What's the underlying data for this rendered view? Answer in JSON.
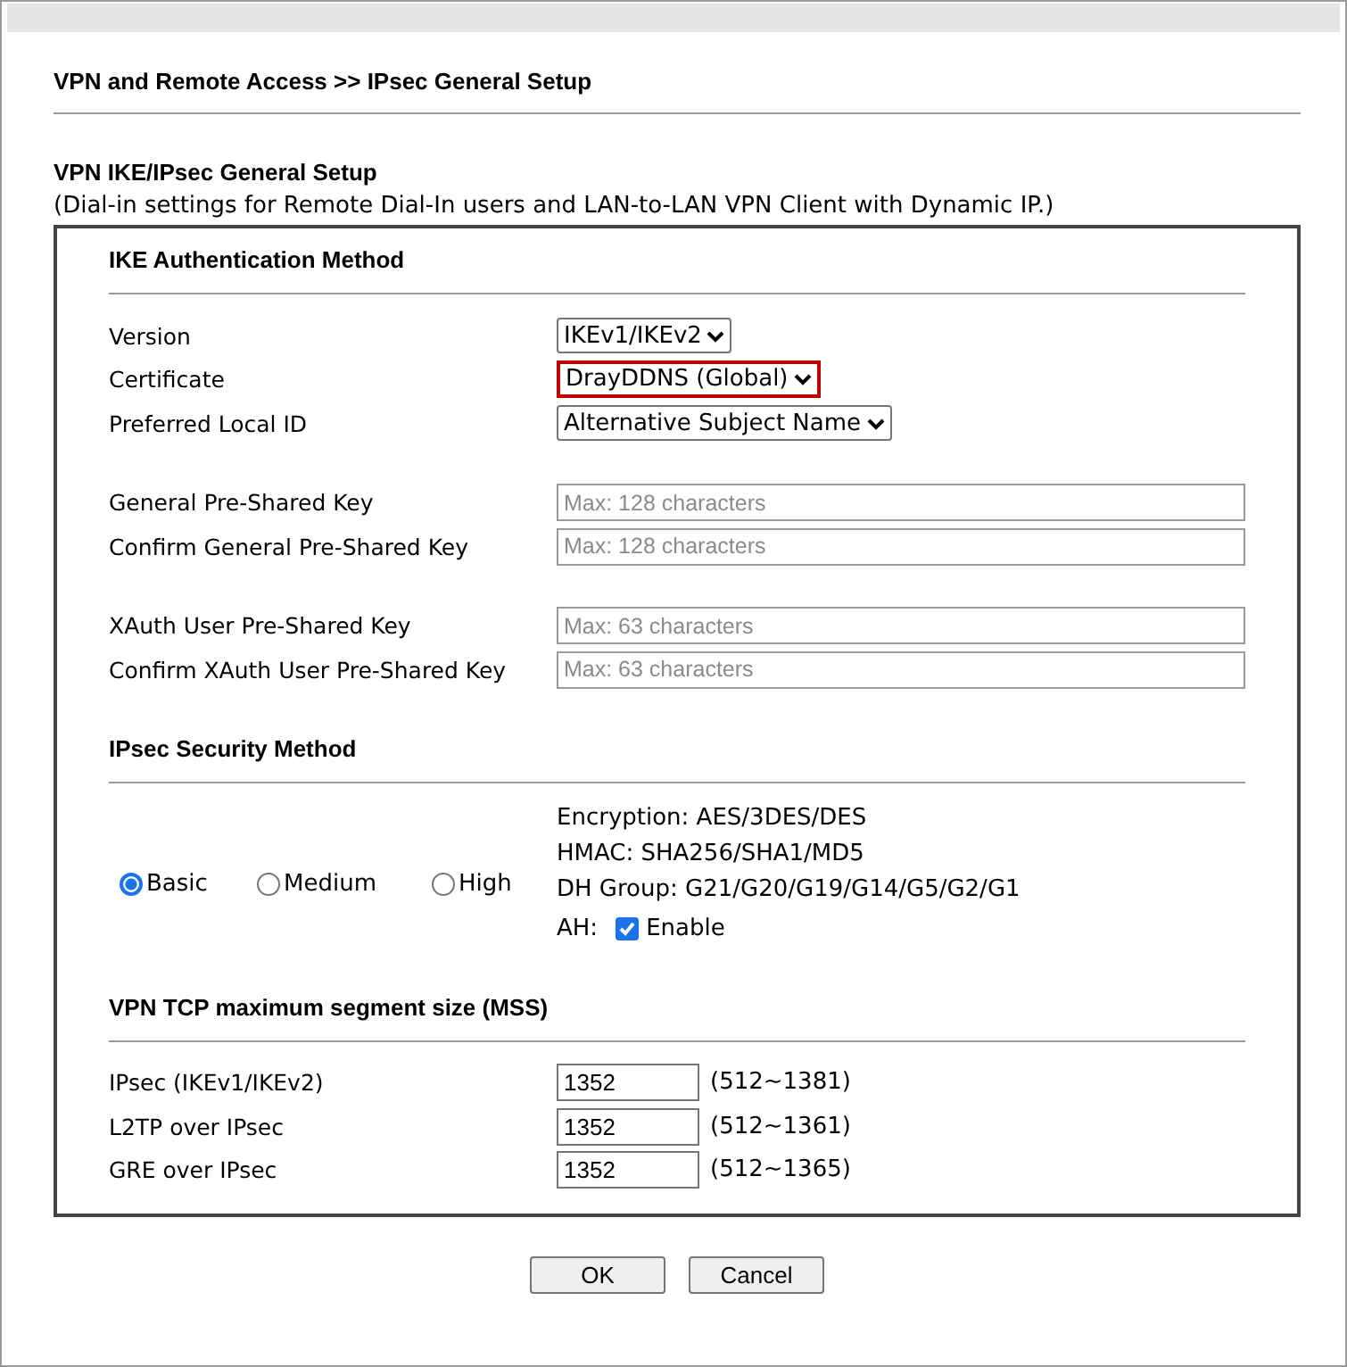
{
  "breadcrumb": "VPN and Remote Access >> IPsec General Setup",
  "section_title": "VPN IKE/IPsec General Setup",
  "description": "(Dial-in settings for Remote Dial-In users and LAN-to-LAN VPN Client with Dynamic IP.)",
  "ike": {
    "heading": "IKE Authentication Method",
    "groups": [
      [
        {
          "kind": "select",
          "label": "Version",
          "value": "IKEv1/IKEv2",
          "highlighted": false
        },
        {
          "kind": "select",
          "label": "Certificate",
          "value": "DrayDDNS (Global)",
          "highlighted": true
        },
        {
          "kind": "select",
          "label": "Preferred Local ID",
          "value": "Alternative Subject Name",
          "highlighted": false
        }
      ],
      [
        {
          "kind": "text",
          "label": "General Pre-Shared Key",
          "placeholder": "Max: 128 characters"
        },
        {
          "kind": "text",
          "label": "Confirm General Pre-Shared Key",
          "placeholder": "Max: 128 characters"
        }
      ],
      [
        {
          "kind": "text",
          "label": "XAuth User Pre-Shared Key",
          "placeholder": "Max: 63 characters"
        },
        {
          "kind": "text",
          "label": "Confirm XAuth User Pre-Shared Key",
          "placeholder": "Max: 63 characters"
        }
      ]
    ]
  },
  "security": {
    "heading": "IPsec Security Method",
    "options": [
      {
        "label": "Basic",
        "selected": true
      },
      {
        "label": "Medium",
        "selected": false
      },
      {
        "label": "High",
        "selected": false
      }
    ],
    "details": [
      "Encryption: AES/3DES/DES",
      "HMAC: SHA256/SHA1/MD5",
      "DH Group: G21/G20/G19/G14/G5/G2/G1"
    ],
    "ah": {
      "label": "AH:",
      "text": "Enable",
      "checked": true
    }
  },
  "mss": {
    "heading": "VPN TCP maximum segment size (MSS)",
    "rows": [
      {
        "label": "IPsec (IKEv1/IKEv2)",
        "value": "1352",
        "range": "(512~1381)"
      },
      {
        "label": "L2TP over IPsec",
        "value": "1352",
        "range": "(512~1361)"
      },
      {
        "label": "GRE over IPsec",
        "value": "1352",
        "range": "(512~1365)"
      }
    ]
  },
  "buttons": [
    "OK",
    "Cancel"
  ]
}
